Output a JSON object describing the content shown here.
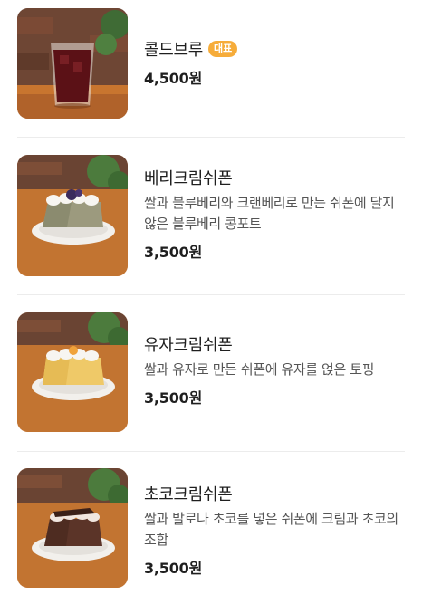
{
  "menu": {
    "items": [
      {
        "name": "콜드브루",
        "badge": "대표",
        "description": "",
        "price": "4,500원",
        "image": "iced-coldbrew-glass"
      },
      {
        "name": "베리크림쉬폰",
        "badge": "",
        "description": "쌀과 블루베리와 크랜베리로 만든 쉬폰에 달지 않은 블루베리 콩포트",
        "price": "3,500원",
        "image": "berry-cream-chiffon-cake"
      },
      {
        "name": "유자크림쉬폰",
        "badge": "",
        "description": "쌀과 유자로 만든 쉬폰에 유자를 얹은 토핑",
        "price": "3,500원",
        "image": "yuzu-cream-chiffon-cake"
      },
      {
        "name": "초코크림쉬폰",
        "badge": "",
        "description": "쌀과 발로나 초코를 넣은 쉬폰에 크림과 초코의 조합",
        "price": "3,500원",
        "image": "choco-cream-chiffon-cake"
      }
    ]
  },
  "colors": {
    "badge": "#f6ac3a",
    "price": "#1f1f1f",
    "description": "#555555",
    "divider": "#ececec"
  }
}
